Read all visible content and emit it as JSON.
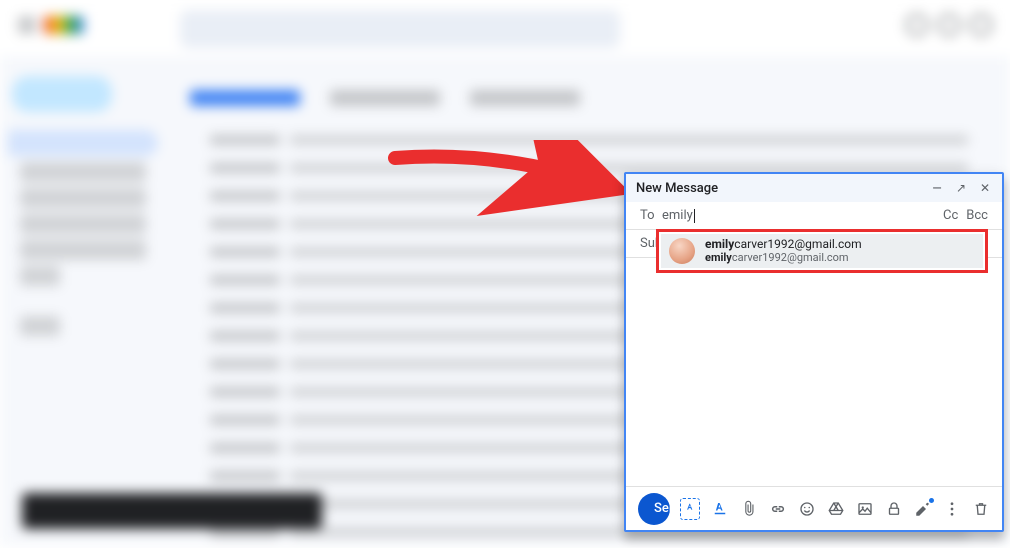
{
  "compose": {
    "title": "New Message",
    "to_label": "To",
    "to_value": "emily",
    "cc_label": "Cc",
    "bcc_label": "Bcc",
    "subject_label": "Sub",
    "send_label": "Send"
  },
  "suggestion": {
    "match": "emily",
    "rest_name": "carver1992@gmail.com",
    "rest_email": "carver1992@gmail.com"
  },
  "icons": {
    "minimize": "—",
    "popout": "↗",
    "close": "✕",
    "send_chevron": "▾"
  }
}
